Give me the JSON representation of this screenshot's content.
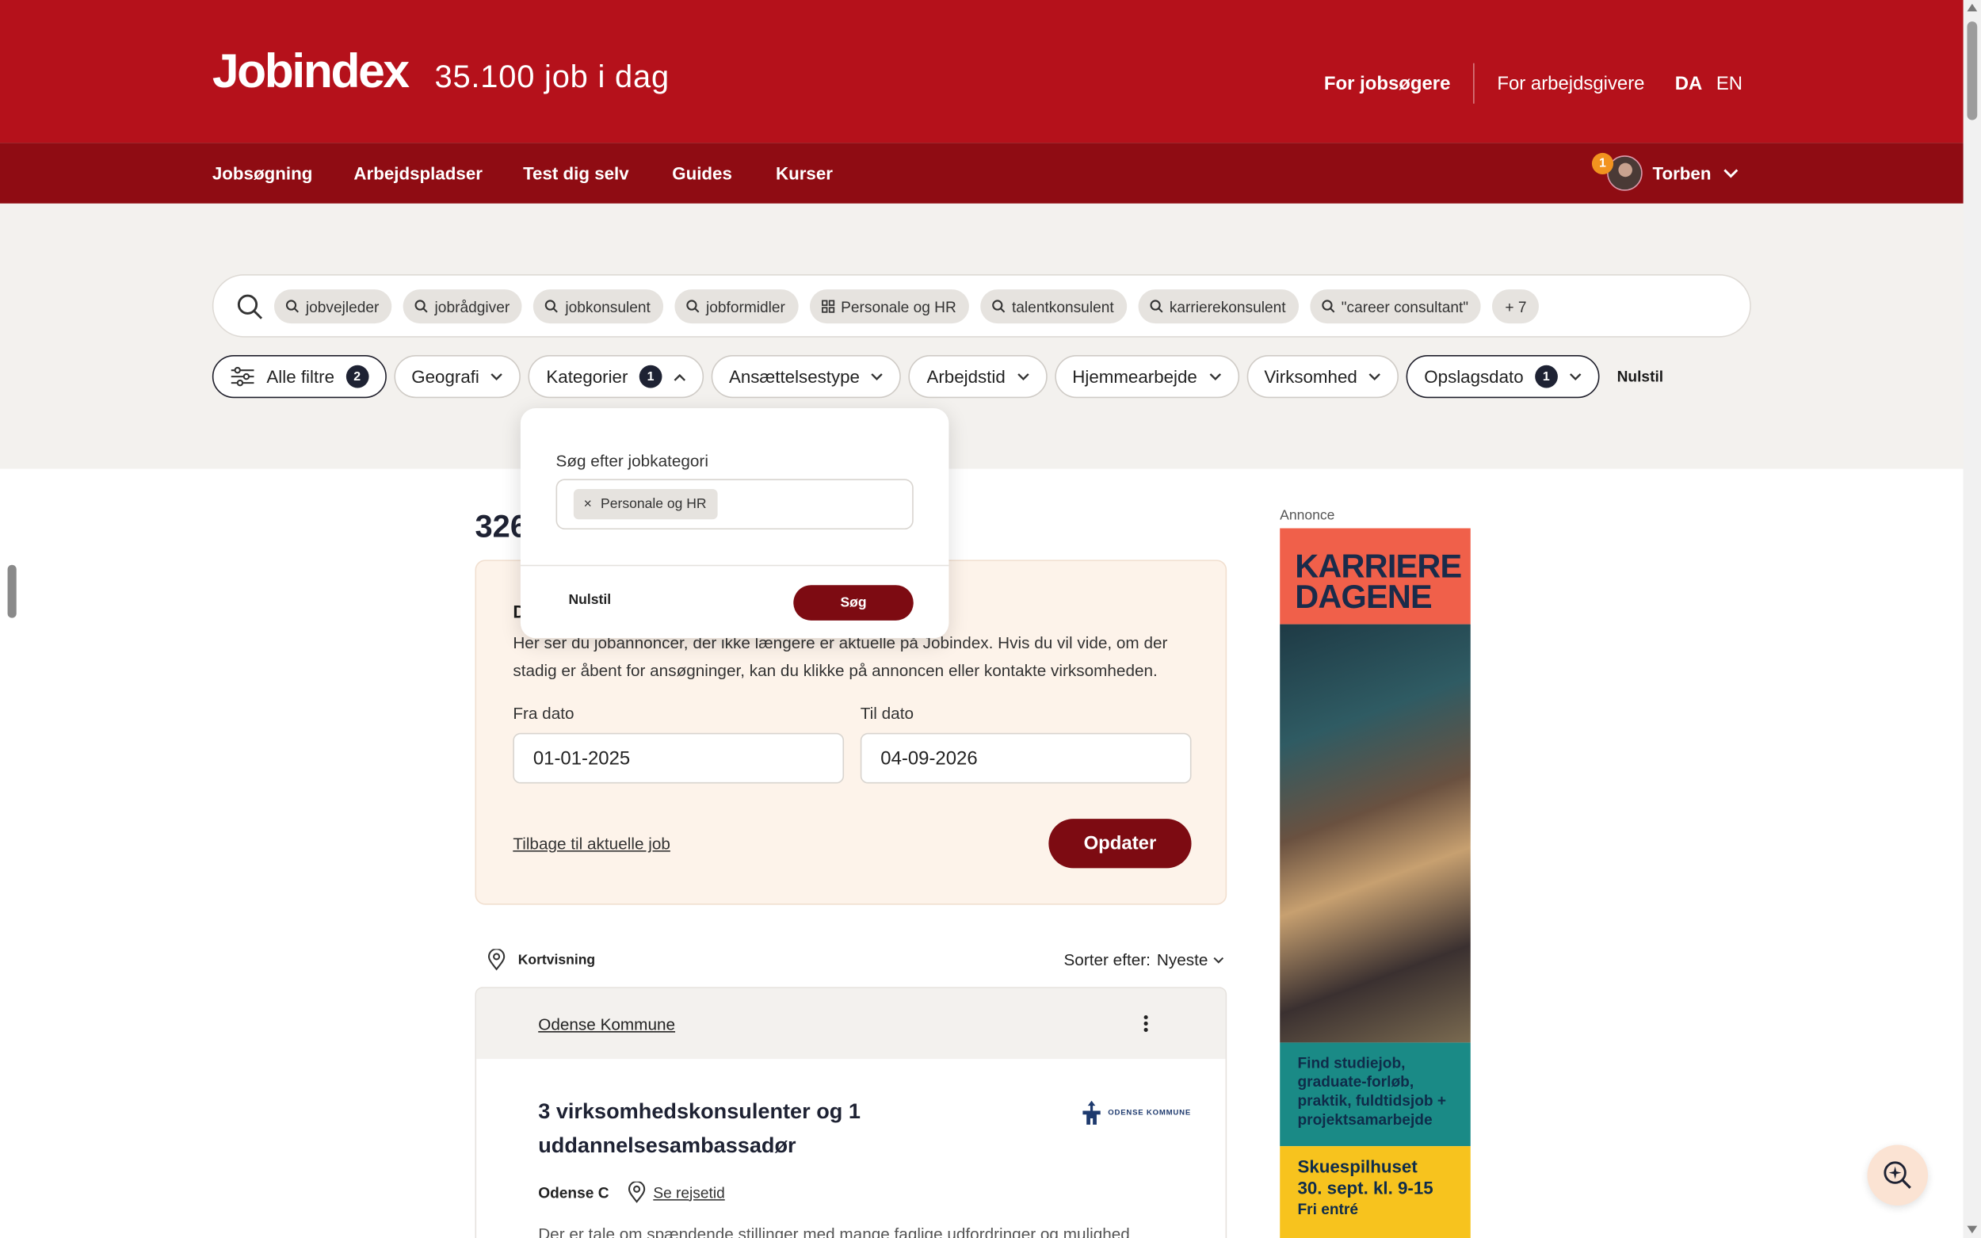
{
  "header": {
    "logo": "Jobindex",
    "job_count": "35.100  job i dag",
    "for_jobseekers": "For jobsøgere",
    "for_employers": "For arbejdsgivere",
    "lang_da": "DA",
    "lang_en": "EN",
    "brand_color": "#b5111b"
  },
  "nav": {
    "items": [
      "Jobsøgning",
      "Arbejdspladser",
      "Test dig selv",
      "Guides",
      "Kurser"
    ],
    "user_name": "Torben",
    "notification_count": "1"
  },
  "search": {
    "chips": [
      "jobvejleder",
      "jobrådgiver",
      "jobkonsulent",
      "jobformidler",
      "Personale og HR",
      "talentkonsulent",
      "karrierekonsulent",
      "\"career consultant\""
    ],
    "more": "+ 7"
  },
  "filters": {
    "all_filters": "Alle filtre",
    "all_filters_count": "2",
    "geografi": "Geografi",
    "kategorier": "Kategorier",
    "kategorier_count": "1",
    "ansaettelsestype": "Ansættelsestype",
    "arbejdstid": "Arbejdstid",
    "hjemmearbejde": "Hjemmearbejde",
    "virksomhed": "Virksomhed",
    "opslagsdato": "Opslagsdato",
    "opslagsdato_count": "1",
    "reset": "Nulstil"
  },
  "dropdown": {
    "label": "Søg efter jobkategori",
    "tag": "Personale og HR",
    "reset": "Nulstil",
    "search": "Søg"
  },
  "results": {
    "heading": "326",
    "box_title": "D",
    "box_desc": "Her ser du jobannoncer, der ikke længere er aktuelle på Jobindex. Hvis du vil vide, om der stadig er åbent for ansøgninger, kan du klikke på annoncen eller kontakte virksomheden.",
    "from_label": "Fra dato",
    "from_value": "01-01-2025",
    "to_label": "Til dato",
    "to_value": "04-09-2026",
    "back_link": "Tilbage til aktuelle job",
    "update": "Opdater",
    "map_view": "Kortvisning",
    "sort_label": "Sorter efter:",
    "sort_value": "Nyeste"
  },
  "job": {
    "company": "Odense Kommune",
    "title": "3 virksomhedskonsulenter og 1 uddannelsesambassadør",
    "logo_text": "ODENSE KOMMUNE",
    "city": "Odense C",
    "travel": "Se rejsetid",
    "snippet": "Der er tale om spændende stillinger med mange faglige udfordringer og mulighed"
  },
  "ad": {
    "label": "Annonce",
    "title_line1": "KARRIERE",
    "title_line2": "DAGENE",
    "green_text": "Find studiejob, graduate-forløb, praktik, fuldtidsjob + projektsamarbejde",
    "yellow_line1": "Skuespilhuset",
    "yellow_line2": "30. sept. kl. 9-15",
    "yellow_line3": "Fri entré"
  }
}
